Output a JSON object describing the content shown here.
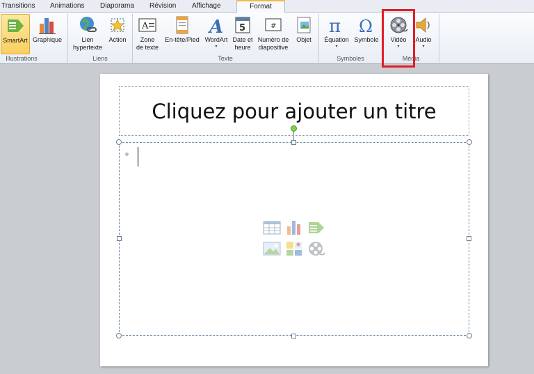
{
  "tabs": {
    "transitions": "Transitions",
    "animations": "Animations",
    "diaporama": "Diaporama",
    "revision": "Révision",
    "affichage": "Affichage",
    "format": "Format"
  },
  "ribbon": {
    "smartart": "SmartArt",
    "graphique": "Graphique",
    "lien_line1": "Lien",
    "lien_line2": "hypertexte",
    "action": "Action",
    "zone_line1": "Zone",
    "zone_line2": "de texte",
    "entete": "En-tête/Pied",
    "wordart": "WordArt",
    "date_line1": "Date et",
    "date_line2": "heure",
    "numero_line1": "Numéro de",
    "numero_line2": "diapositive",
    "objet": "Objet",
    "equation": "Équation",
    "symbole": "Symbole",
    "video": "Vidéo",
    "audio": "Audio",
    "groups": {
      "illustrations": "Illustrations",
      "liens": "Liens",
      "texte": "Texte",
      "symboles": "Symboles",
      "media": "Média"
    }
  },
  "slide": {
    "title_placeholder": "Cliquez pour ajouter un titre"
  },
  "colors": {
    "highlight": "#e01d25",
    "tab_active_accent": "#f2b84a"
  }
}
